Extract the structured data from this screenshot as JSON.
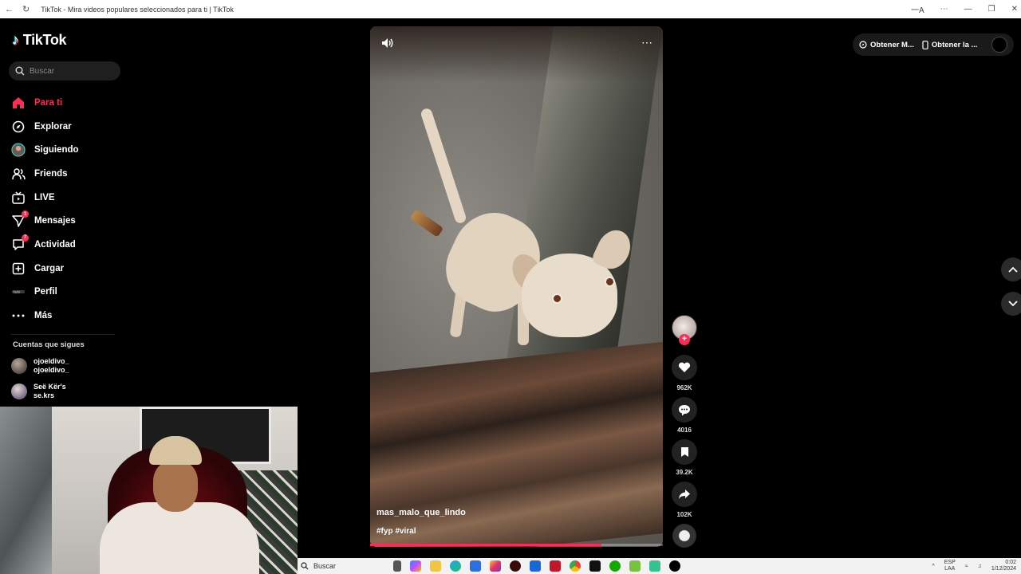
{
  "browser": {
    "tab_title": "TikTok - Mira videos populares seleccionados para ti | TikTok",
    "icons": [
      "back-icon",
      "refresh-icon",
      "translate-icon",
      "more-icon",
      "minimize-icon",
      "restore-icon",
      "close-icon"
    ]
  },
  "logo": "TikTok",
  "search": {
    "placeholder": "Buscar"
  },
  "nav": [
    {
      "label": "Para ti",
      "icon": "home-icon",
      "active": true
    },
    {
      "label": "Explorar",
      "icon": "compass-icon"
    },
    {
      "label": "Siguiendo",
      "icon": "following-avatar-icon"
    },
    {
      "label": "Friends",
      "icon": "friends-icon"
    },
    {
      "label": "LIVE",
      "icon": "live-tv-icon"
    },
    {
      "label": "Mensajes",
      "icon": "message-icon",
      "badge": "1"
    },
    {
      "label": "Actividad",
      "icon": "activity-icon",
      "badge": "7"
    },
    {
      "label": "Cargar",
      "icon": "upload-icon"
    },
    {
      "label": "Perfil",
      "icon": "profile-icon"
    },
    {
      "label": "Más",
      "icon": "more-dots-icon"
    }
  ],
  "following": {
    "title": "Cuentas que sigues",
    "accounts": [
      {
        "name": "ojoeldivo_",
        "handle": "ojoeldivo_"
      },
      {
        "name": "Seë Kër's",
        "handle": "se.krs"
      }
    ]
  },
  "video": {
    "author": "mas_malo_que_lindo",
    "tags": "#fyp #viral",
    "progress": 0.79
  },
  "actions": {
    "likes": "962K",
    "comments": "4016",
    "saves": "39.2K",
    "shares": "102K"
  },
  "topbar": {
    "get_app_1": "Obtener M...",
    "get_app_2": "Obtener la ..."
  },
  "taskbar": {
    "search_placeholder": "Buscar",
    "lang_line1": "ESP",
    "lang_line2": "LAA",
    "time": "0:02",
    "date": "1/12/2024"
  },
  "colors": {
    "accent": "#fe2c55",
    "background": "#000000"
  }
}
